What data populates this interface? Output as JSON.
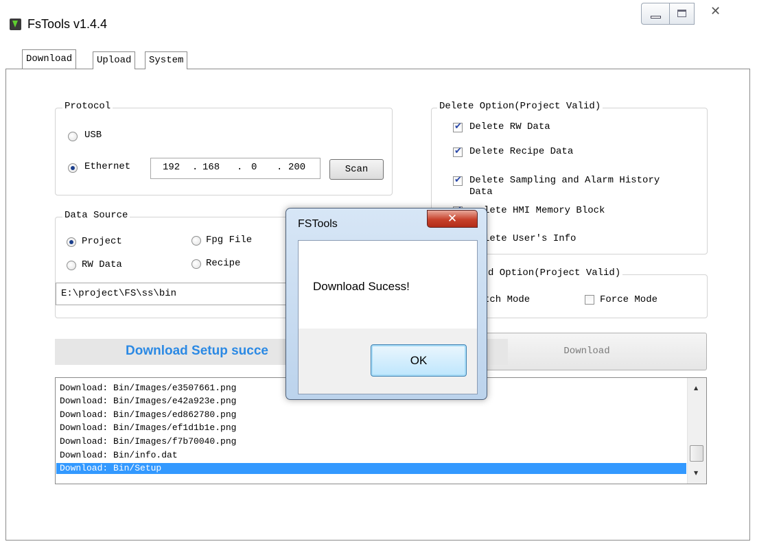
{
  "window": {
    "title": "FsTools v1.4.4",
    "close_glyph": "✕"
  },
  "tabs": [
    {
      "label": "Download",
      "active": true
    },
    {
      "label": "Upload",
      "active": false
    },
    {
      "label": "System",
      "active": false
    }
  ],
  "protocol": {
    "title": "Protocol",
    "usb_label": "USB",
    "ethernet_label": "Ethernet",
    "selected": "Ethernet",
    "ip": [
      "192",
      "168",
      "0",
      "200"
    ],
    "ip_dot": ".",
    "scan_label": "Scan"
  },
  "data_source": {
    "title": "Data Source",
    "project_label": "Project",
    "fpg_file_label": "Fpg File",
    "rw_data_label": "RW Data",
    "recipe_label": "Recipe",
    "selected": "Project",
    "path": "E:\\project\\FS\\ss\\bin"
  },
  "delete_option": {
    "title": "Delete Option(Project Valid)",
    "items": [
      {
        "label": "Delete RW Data",
        "checked": true
      },
      {
        "label": "Delete Recipe Data",
        "checked": true
      },
      {
        "label": "Delete Sampling and Alarm History",
        "label2": "Data",
        "checked": true
      },
      {
        "label": "lete HMI Memory Block",
        "checked": true
      },
      {
        "label": "lete User's Info",
        "checked": false
      }
    ]
  },
  "download_option": {
    "title": "d Option(Project Valid)",
    "batch_label": "tch Mode",
    "force_label": "Force Mode",
    "force_checked": false
  },
  "download_button_label": "Download",
  "status_text": "Download Setup succe",
  "log": [
    "Download: Bin/Images/e3507661.png",
    "Download: Bin/Images/e42a923e.png",
    "Download: Bin/Images/ed862780.png",
    "Download: Bin/Images/ef1d1b1e.png",
    "Download: Bin/Images/f7b70040.png",
    "Download: Bin/info.dat",
    "Download: Bin/Setup"
  ],
  "log_selected_index": 6,
  "scroll": {
    "up_glyph": "▲",
    "down_glyph": "▼"
  },
  "dialog": {
    "title": "FSTools",
    "message": "Download Sucess!",
    "ok_label": "OK",
    "close_glyph": "✕"
  }
}
